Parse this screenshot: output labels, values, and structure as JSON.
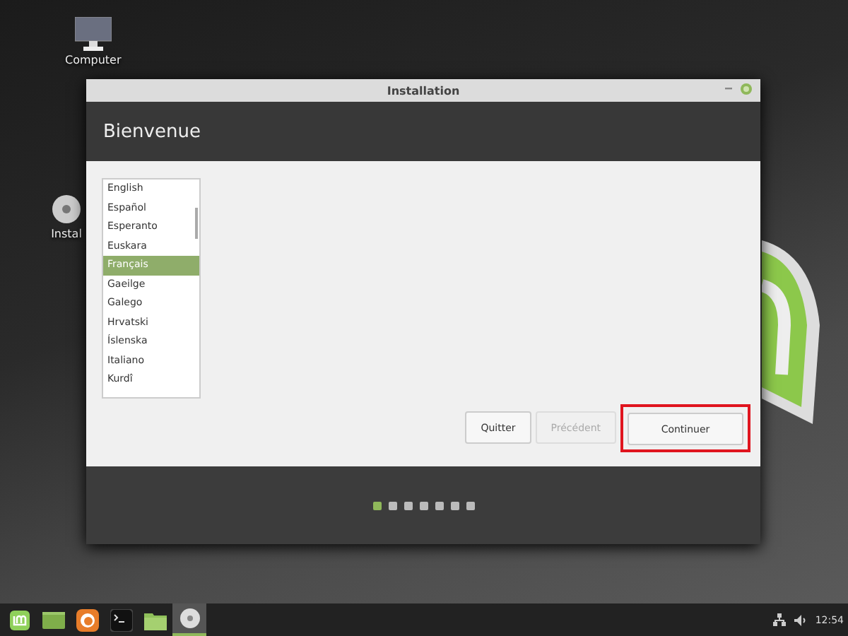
{
  "desktop": {
    "icons": [
      {
        "kind": "computer",
        "label": "Computer"
      },
      {
        "kind": "installer",
        "label": "Instal"
      }
    ]
  },
  "window": {
    "title": "Installation",
    "heading": "Bienvenue",
    "languages": [
      {
        "label": "English",
        "selected": false
      },
      {
        "label": "Español",
        "selected": false
      },
      {
        "label": "Esperanto",
        "selected": false
      },
      {
        "label": "Euskara",
        "selected": false
      },
      {
        "label": "Français",
        "selected": true
      },
      {
        "label": "Gaeilge",
        "selected": false
      },
      {
        "label": "Galego",
        "selected": false
      },
      {
        "label": "Hrvatski",
        "selected": false
      },
      {
        "label": "Íslenska",
        "selected": false
      },
      {
        "label": "Italiano",
        "selected": false
      },
      {
        "label": "Kurdî",
        "selected": false
      }
    ],
    "buttons": [
      {
        "label": "Quitter",
        "disabled": false,
        "highlighted": false
      },
      {
        "label": "Précédent",
        "disabled": true,
        "highlighted": false
      },
      {
        "label": "Continuer",
        "disabled": false,
        "highlighted": true
      }
    ],
    "steps": [
      {
        "selected": true
      },
      {
        "selected": false
      },
      {
        "selected": false
      },
      {
        "selected": false
      },
      {
        "selected": false
      },
      {
        "selected": false
      },
      {
        "selected": false
      }
    ]
  },
  "taskbar": {
    "apps": [
      {
        "kind": "menu",
        "active": false
      },
      {
        "kind": "desktop",
        "active": false
      },
      {
        "kind": "browser",
        "active": false
      },
      {
        "kind": "terminal",
        "active": false
      },
      {
        "kind": "folder",
        "active": false
      },
      {
        "kind": "disc",
        "active": true
      }
    ],
    "clock": "12:54"
  }
}
